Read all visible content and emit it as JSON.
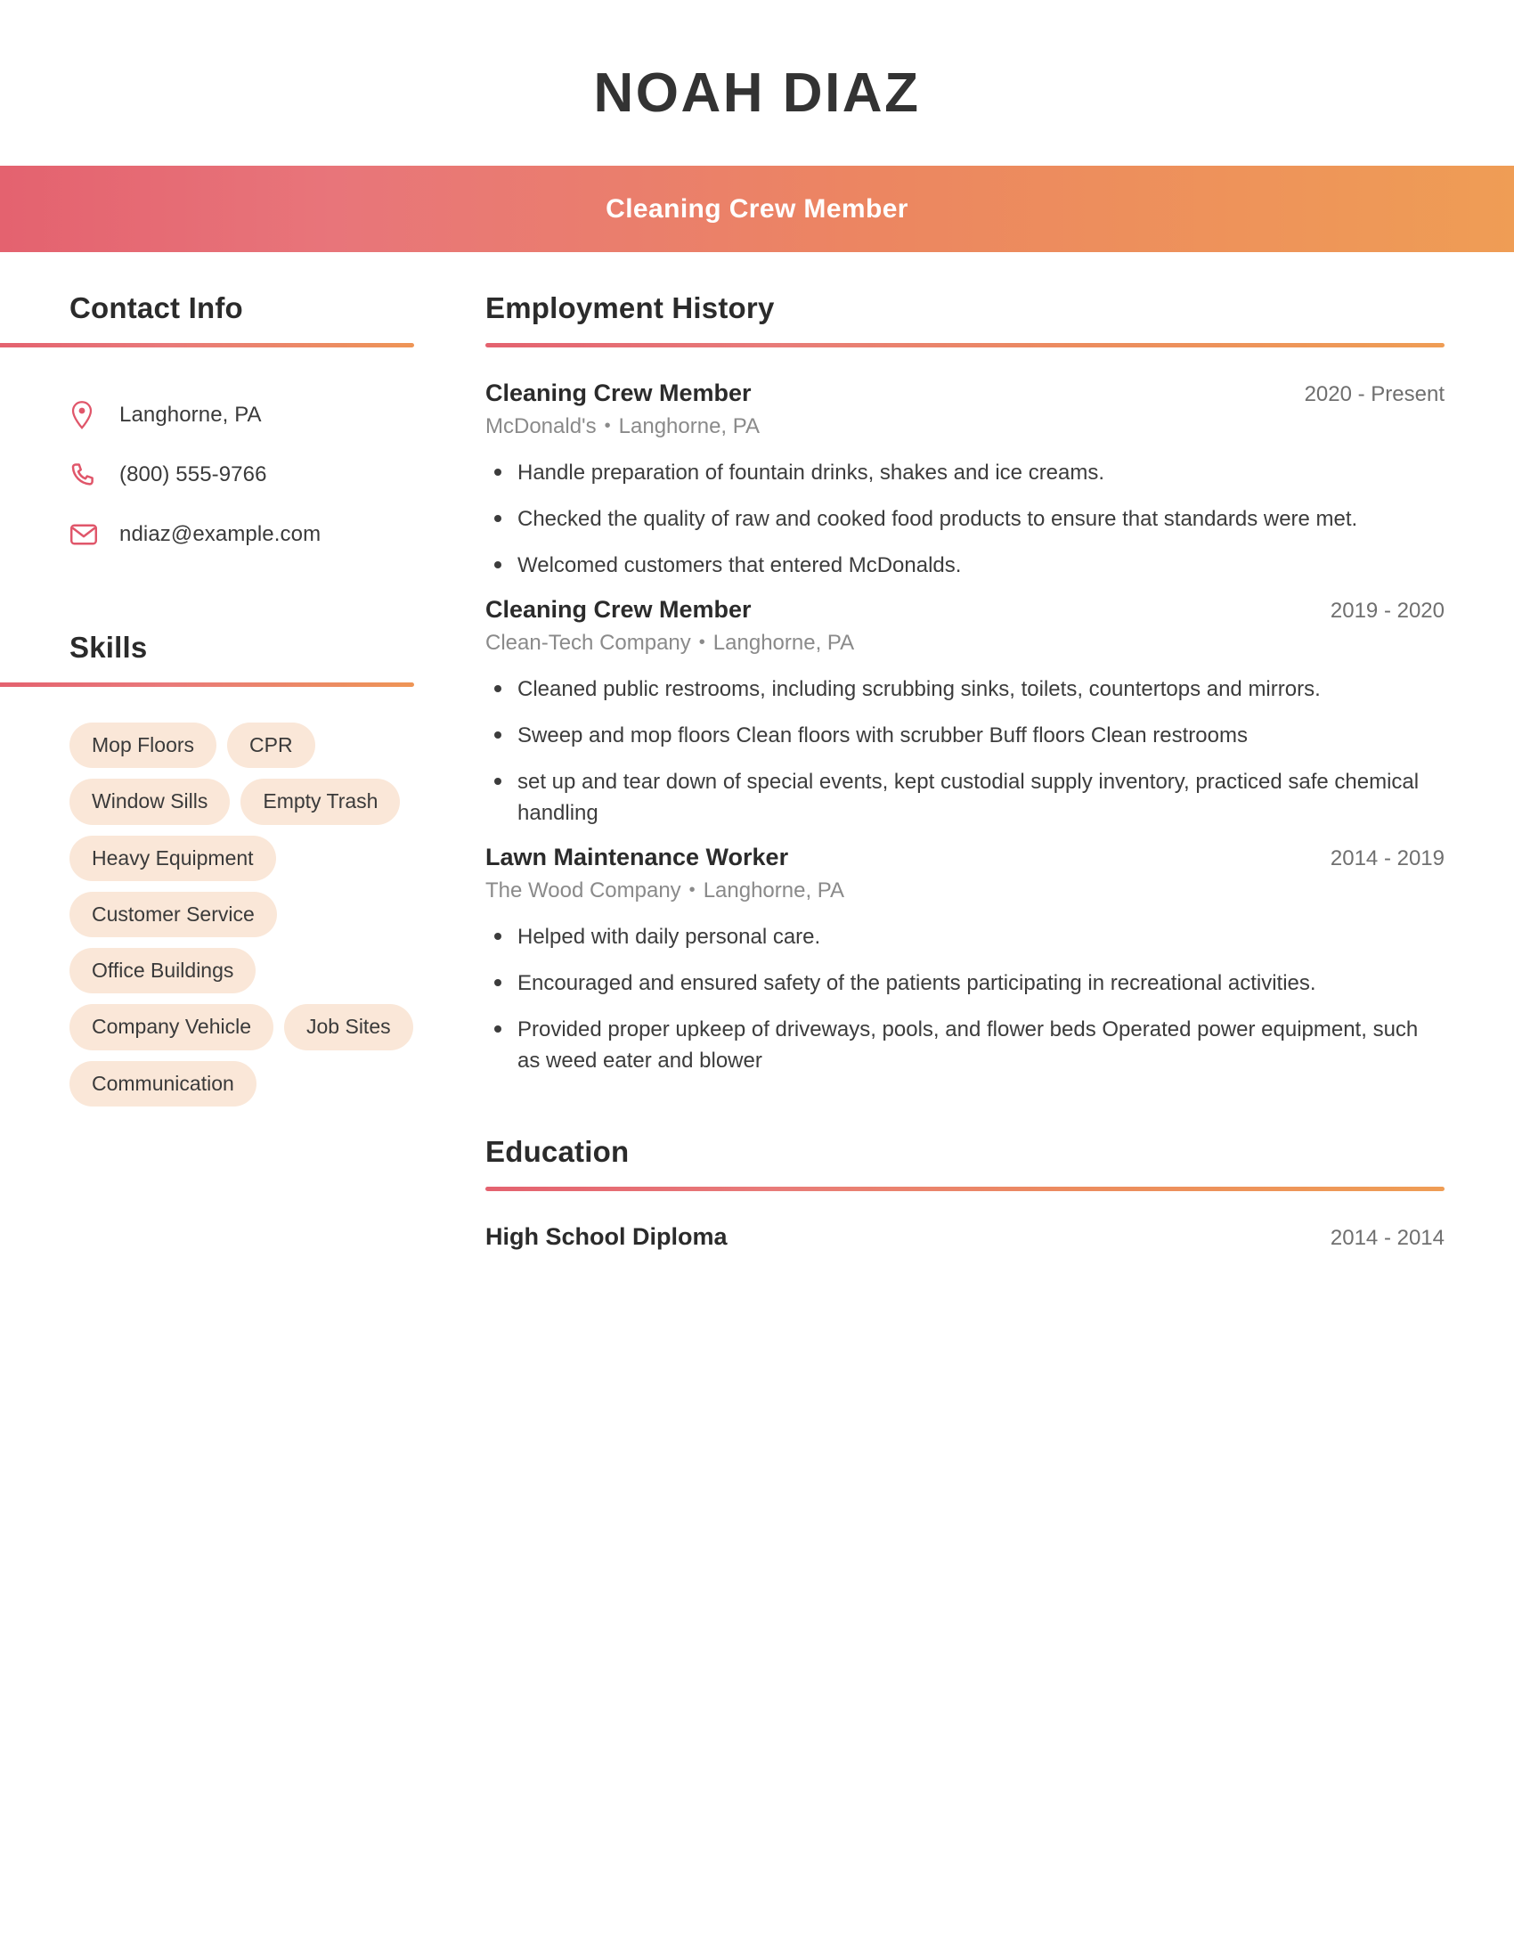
{
  "header": {
    "name": "NOAH DIAZ",
    "job_title": "Cleaning Crew Member",
    "band_gradient_start": "#E4626F",
    "band_gradient_end": "#EF9D55"
  },
  "sidebar": {
    "contact": {
      "heading": "Contact Info",
      "items": [
        {
          "icon": "location-pin-icon",
          "value": "Langhorne, PA"
        },
        {
          "icon": "phone-icon",
          "value": "(800) 555-9766"
        },
        {
          "icon": "envelope-icon",
          "value": "ndiaz@example.com"
        }
      ]
    },
    "skills": {
      "heading": "Skills",
      "pill_background": "#FAE7D8",
      "items": [
        "Mop Floors",
        "CPR",
        "Window Sills",
        "Empty Trash",
        "Heavy Equipment",
        "Customer Service",
        "Office Buildings",
        "Company Vehicle",
        "Job Sites",
        "Communication"
      ]
    }
  },
  "main": {
    "employment": {
      "heading": "Employment History",
      "jobs": [
        {
          "role": "Cleaning Crew Member",
          "dates": "2020 - Present",
          "company": "McDonald's",
          "location": "Langhorne, PA",
          "bullets": [
            "Handle preparation of fountain drinks, shakes and ice creams.",
            "Checked the quality of raw and cooked food products to ensure that standards were met.",
            "Welcomed customers that entered McDonalds."
          ]
        },
        {
          "role": "Cleaning Crew Member",
          "dates": "2019 - 2020",
          "company": "Clean-Tech Company",
          "location": "Langhorne, PA",
          "bullets": [
            "Cleaned public restrooms, including scrubbing sinks, toilets, countertops and mirrors.",
            "Sweep and mop floors Clean floors with scrubber Buff floors Clean restrooms",
            "set up and tear down of special events, kept custodial supply inventory, practiced safe chemical handling"
          ]
        },
        {
          "role": "Lawn Maintenance Worker",
          "dates": "2014 - 2019",
          "company": "The Wood Company",
          "location": "Langhorne, PA",
          "bullets": [
            "Helped with daily personal care.",
            "Encouraged and ensured safety of the patients participating in recreational activities.",
            "Provided proper upkeep of driveways, pools, and flower beds Operated power equipment, such as weed eater and blower"
          ]
        }
      ]
    },
    "education": {
      "heading": "Education",
      "entries": [
        {
          "degree": "High School Diploma",
          "dates": "2014 - 2014"
        }
      ]
    }
  },
  "separator": "•"
}
